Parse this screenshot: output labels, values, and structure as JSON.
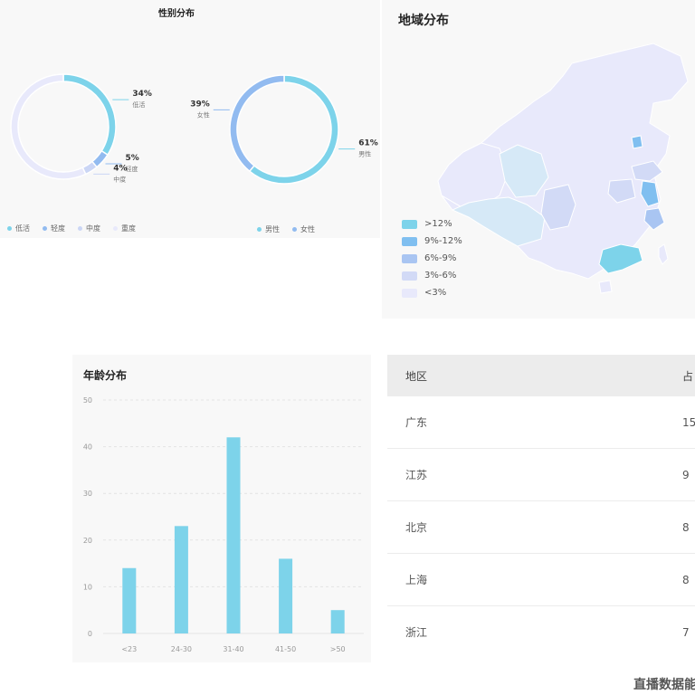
{
  "charts_header": {
    "gender_title": "性别分布",
    "region_title": "地域分布",
    "age_title": "年龄分布"
  },
  "chart_data": [
    {
      "type": "pie",
      "title": "",
      "slices": [
        {
          "label": "低活",
          "value": 34,
          "text": "34%",
          "color": "#7dd3ea"
        },
        {
          "label": "轻度",
          "value": 5,
          "text": "5%",
          "color": "#92bbf0"
        },
        {
          "label": "中度",
          "value": 4,
          "text": "4%",
          "color": "#cbd6f5"
        },
        {
          "label": "重度",
          "value": 57,
          "text": "",
          "color": "#e8e9fb"
        }
      ],
      "legend": [
        "低活",
        "轻度",
        "中度",
        "重度"
      ]
    },
    {
      "type": "pie",
      "title": "性别分布",
      "slices": [
        {
          "label": "男性",
          "value": 61,
          "text": "61%",
          "color": "#7dd3ea"
        },
        {
          "label": "女性",
          "value": 39,
          "text": "39%",
          "color": "#92bbf0"
        }
      ],
      "legend": [
        "男性",
        "女性"
      ]
    },
    {
      "type": "bar",
      "title": "年龄分布",
      "categories": [
        "<23",
        "24-30",
        "31-40",
        "41-50",
        ">50"
      ],
      "values": [
        14,
        23,
        42,
        16,
        5
      ],
      "ylim": [
        0,
        50
      ],
      "yticks": [
        0,
        10,
        20,
        30,
        40,
        50
      ],
      "color": "#7dd3ea",
      "grid": true
    }
  ],
  "map_legend": [
    {
      "label": ">12%",
      "color": "#7dd3ea"
    },
    {
      "label": "9%-12%",
      "color": "#80bff0"
    },
    {
      "label": "6%-9%",
      "color": "#a9c5f2"
    },
    {
      "label": "3%-6%",
      "color": "#d2daf6"
    },
    {
      "label": "<3%",
      "color": "#e8e9fb"
    }
  ],
  "region_table": {
    "header_region": "地区",
    "header_share": "占",
    "rows": [
      {
        "region": "广东",
        "share": "15"
      },
      {
        "region": "江苏",
        "share": "9"
      },
      {
        "region": "北京",
        "share": "8"
      },
      {
        "region": "上海",
        "share": "8"
      },
      {
        "region": "浙江",
        "share": "7"
      }
    ]
  },
  "footer": {
    "text": "直播数据能"
  }
}
